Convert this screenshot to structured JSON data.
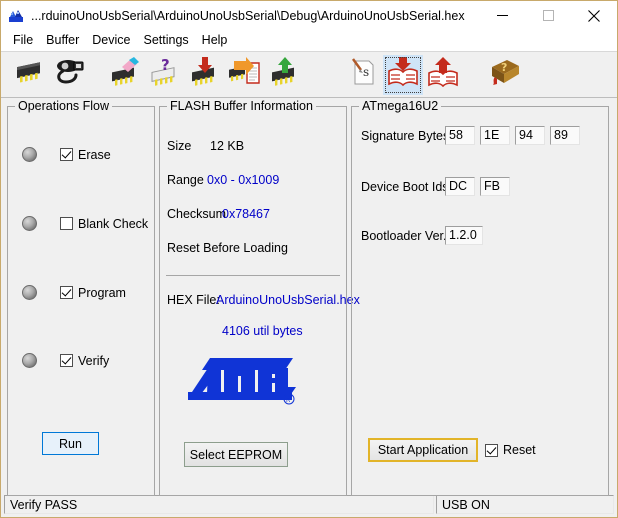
{
  "window": {
    "title": "...rduinoUnoUsbSerial\\ArduinoUnoUsbSerial\\Debug\\ArduinoUnoUsbSerial.hex",
    "app_icon": "flip-app-icon",
    "minimize_label": "minimize-icon",
    "maximize_label": "maximize-icon",
    "close_label": "close-icon",
    "border_color": "#c8a96b"
  },
  "menu": {
    "items": [
      {
        "label": "File"
      },
      {
        "label": "Buffer"
      },
      {
        "label": "Device"
      },
      {
        "label": "Settings"
      },
      {
        "label": "Help"
      }
    ]
  },
  "toolbar": {
    "buttons": [
      {
        "icon": "chip-icon",
        "selected": false
      },
      {
        "icon": "usb-cable-icon",
        "selected": false
      },
      {
        "icon": "chip-erase-icon",
        "selected": false
      },
      {
        "icon": "chip-blank-check-icon",
        "selected": false
      },
      {
        "icon": "chip-program-icon",
        "selected": false
      },
      {
        "icon": "chip-read-icon",
        "selected": false
      },
      {
        "icon": "chip-verify-icon",
        "selected": false
      },
      {
        "icon": "edit-file-icon",
        "selected": false
      },
      {
        "icon": "load-buffer-icon",
        "selected": true
      },
      {
        "icon": "save-buffer-icon",
        "selected": false
      },
      {
        "icon": "help-book-icon",
        "selected": false
      }
    ]
  },
  "operations": {
    "title": "Operations Flow",
    "rows": [
      {
        "led": "off",
        "checked": true,
        "label": "Erase"
      },
      {
        "led": "off",
        "checked": false,
        "label": "Blank Check"
      },
      {
        "led": "off",
        "checked": true,
        "label": "Program"
      },
      {
        "led": "off",
        "checked": true,
        "label": "Verify"
      }
    ],
    "run_label": "Run"
  },
  "flash": {
    "title": "FLASH Buffer Information",
    "size_label": "Size",
    "size_value": "12 KB",
    "range_label": "Range",
    "range_value": "0x0 - 0x1009",
    "checksum_label": "Checksum",
    "checksum_value": "0x78467",
    "reset_before_loading_label": "Reset Before Loading",
    "hex_file_label": "HEX File:",
    "hex_file_value": "ArduinoUnoUsbSerial.hex",
    "util_bytes": "4106 util bytes",
    "logo_alt": "atmel-logo",
    "select_eeprom_label": "Select EEPROM",
    "value_color": "#0000c8"
  },
  "mcu": {
    "title": "ATmega16U2",
    "signature_label": "Signature Bytes",
    "signature_bytes": [
      "58",
      "1E",
      "94",
      "89"
    ],
    "boot_ids_label": "Device Boot Ids",
    "boot_ids": [
      "DC",
      "FB"
    ],
    "bootloader_label": "Bootloader Ver.",
    "bootloader_value": "1.2.0",
    "start_application_label": "Start Application",
    "start_application_border": "#e2b429",
    "reset_label": "Reset",
    "reset_checked": true
  },
  "statusbar": {
    "left": "Verify PASS",
    "right": "USB ON"
  }
}
